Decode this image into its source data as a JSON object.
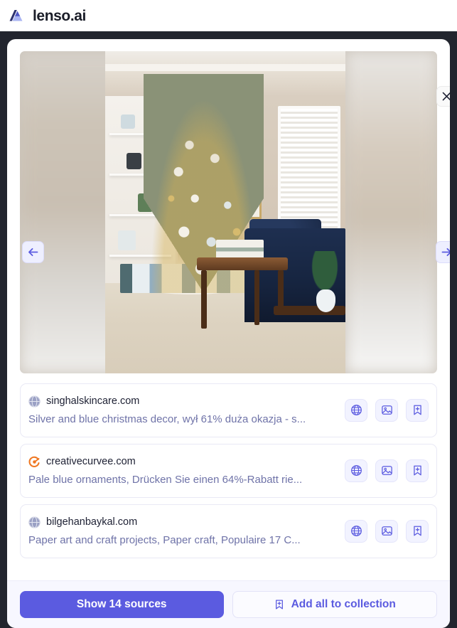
{
  "brand": {
    "name": "lenso.ai",
    "logo_icon": "lenso-logo-icon",
    "accent_color": "#5b5be0",
    "logo_dark": "#262a4a",
    "logo_light": "#a9b4f2"
  },
  "viewer": {
    "prev_icon": "arrow-left-icon",
    "next_icon": "arrow-right-icon",
    "close_icon": "close-icon",
    "image_alt": "Christmas tree with gold and blue ornaments in a living room"
  },
  "sources": {
    "items": [
      {
        "domain": "singhalskincare.com",
        "title": "Silver and blue christmas decor, wył 61% duża okazja - s...",
        "favicon": "globe-favicon",
        "favicon_style": "globe",
        "actions": [
          {
            "icon": "globe-icon",
            "name": "open-website-button"
          },
          {
            "icon": "image-icon",
            "name": "open-image-button"
          },
          {
            "icon": "bookmark-plus-icon",
            "name": "add-to-collection-button"
          }
        ]
      },
      {
        "domain": "creativecurvee.com",
        "title": "Pale blue ornaments, Drücken Sie einen 64%-Rabatt rie...",
        "favicon": "swirl-favicon",
        "favicon_style": "swirl",
        "actions": [
          {
            "icon": "globe-icon",
            "name": "open-website-button"
          },
          {
            "icon": "image-icon",
            "name": "open-image-button"
          },
          {
            "icon": "bookmark-plus-icon",
            "name": "add-to-collection-button"
          }
        ]
      },
      {
        "domain": "bilgehanbaykal.com",
        "title": "Paper art and craft projects, Paper craft, Populaire 17 C...",
        "favicon": "globe-favicon",
        "favicon_style": "globe",
        "actions": [
          {
            "icon": "globe-icon",
            "name": "open-website-button"
          },
          {
            "icon": "image-icon",
            "name": "open-image-button"
          },
          {
            "icon": "bookmark-plus-icon",
            "name": "add-to-collection-button"
          }
        ]
      }
    ]
  },
  "footer": {
    "show_sources_label": "Show 14 sources",
    "add_all_label": "Add all to collection",
    "add_all_icon": "bookmark-plus-icon"
  }
}
